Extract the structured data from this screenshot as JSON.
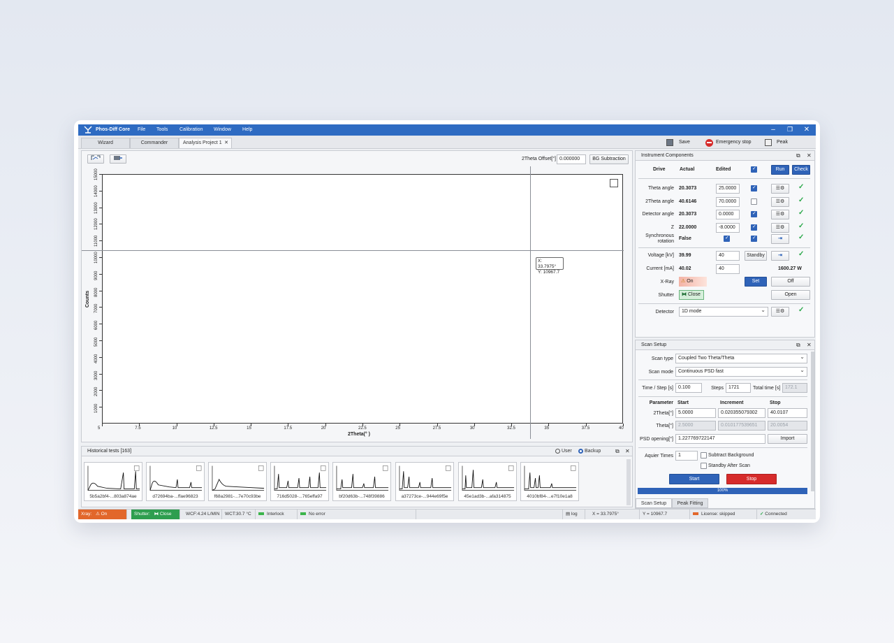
{
  "app": {
    "title": "Phos-Diff Core",
    "menu": [
      "File",
      "Tools",
      "Calibration",
      "Window",
      "Help"
    ]
  },
  "tabs": {
    "wizard": "Wizard",
    "commander": "Commander",
    "project": "Analysis Project 1"
  },
  "toolbar": {
    "save": "Save",
    "emergency_stop": "Emergency stop",
    "peak": "Peak"
  },
  "plot": {
    "offset_label": "2Theta Offset[°]",
    "offset_value": "0.000000",
    "bg_subtraction": "BG Subtraction",
    "tooltip_x": "X: 33.7975°",
    "tooltip_y": "Y: 10967.7"
  },
  "chart_data": {
    "type": "line",
    "xlabel": "2Theta(° )",
    "ylabel": "Counts",
    "xlim": [
      5,
      40
    ],
    "ylim": [
      0,
      15000
    ],
    "xticks": [
      "5",
      "7.5",
      "10",
      "12.5",
      "15",
      "17.5",
      "20",
      "22.5",
      "25",
      "27.5",
      "30",
      "32.5",
      "35",
      "37.5",
      "40"
    ],
    "yticks": [
      "1000",
      "2000",
      "3000",
      "4000",
      "5000",
      "6000",
      "7000",
      "8000",
      "9000",
      "10000",
      "11000",
      "12000",
      "13000",
      "14000",
      "15000"
    ],
    "series": [],
    "cursor": {
      "x": 33.7975,
      "y": 10967.7
    }
  },
  "instrument": {
    "title": "Instrument Components",
    "headers": {
      "drive": "Drive",
      "actual": "Actual",
      "edited": "Edited"
    },
    "run": "Run",
    "check": "Check",
    "rows": [
      {
        "label": "Theta angle",
        "actual": "20.3073",
        "edited": "25.0000"
      },
      {
        "label": "2Theta angle",
        "actual": "40.6146",
        "edited": "70.0000"
      },
      {
        "label": "Detector angle",
        "actual": "20.3073",
        "edited": "0.0000"
      },
      {
        "label": "Z",
        "actual": "22.0000",
        "edited": "-8.0000"
      }
    ],
    "sync_label_1": "Synchronous",
    "sync_label_2": "rotation",
    "sync_value": "False",
    "voltage_label": "Voltage [kV]",
    "voltage_actual": "39.99",
    "voltage_edit": "40",
    "standby": "Standby",
    "current_label": "Current [mA]",
    "current_actual": "40.02",
    "current_edit": "40",
    "power": "1600.27 W",
    "xray_label": "X-Ray",
    "xray_state": "On",
    "set": "Set",
    "off": "Off",
    "shutter_label": "Shutter",
    "shutter_state": "Close",
    "open": "Open",
    "detector_label": "Detector",
    "detector_mode": "1D mode"
  },
  "scan": {
    "title": "Scan Setup",
    "scan_type_label": "Scan type",
    "scan_type": "Coupled Two Theta/Theta",
    "scan_mode_label": "Scan mode",
    "scan_mode": "Continuous PSD fast",
    "time_label": "Time / Step [s]",
    "time": "0.100",
    "steps_label": "Steps",
    "steps": "1721",
    "total_label": "Total time [s]",
    "total": "172.1",
    "param_header": "Parameter",
    "start_header": "Start",
    "increment_header": "Increment",
    "stop_header": "Stop",
    "twotheta_label": "2Theta[°]",
    "twotheta_start": "5.0000",
    "twotheta_inc": "0.020355079302",
    "twotheta_stop": "40.0107",
    "theta_label": "Theta[°]",
    "theta_start": "2.5000",
    "theta_inc": "0.010177539651",
    "theta_stop": "20.0054",
    "psd_label": "PSD opening[°]",
    "psd_value": "1.227769722147",
    "import": "Import",
    "aquire_label": "Aquier Times",
    "aquire_value": "1",
    "subtract_bg": "Subtract Background",
    "standby_after": "Standby After Scan",
    "start_btn": "Start",
    "stop_btn": "Stop",
    "progress": "100%",
    "progress_value": 1.0,
    "tab_scan": "Scan Setup",
    "tab_peak": "Peak Fitting"
  },
  "history": {
    "title": "Historical tests [163]",
    "user": "User",
    "backup": "Backup",
    "items": [
      "5b5a2bf4-...803a874ae",
      "d72694ba-...ffae96823",
      "f68a2981-...7e70c93be",
      "716d5028-...765effa97",
      "bf20d63b-...748f39886",
      "a37273ce-...944e69f5e",
      "45e1ad3b-...afa314875",
      "4010bf84-...e7f10e1a8"
    ]
  },
  "status": {
    "xray": "Xray:",
    "xray_state": "On",
    "shutter": "Shutter:",
    "shutter_state": "Close",
    "wcf": "WCF:4.24 L/MIN",
    "wct": "WCT:30.7 °C",
    "interlock": "Interlock",
    "no_error": "No error",
    "log": "log",
    "x": "X = 33.7975°",
    "y": "Y = 10967.7",
    "license": "License: skipped",
    "connected": "Connected"
  },
  "colors": {
    "titlebar": "#2e6bc2",
    "accent": "#2f63b8",
    "danger": "#d62b2b",
    "ok": "#2ba84a",
    "xray_status": "#e2672b",
    "shutter_status": "#2e9e4f"
  }
}
